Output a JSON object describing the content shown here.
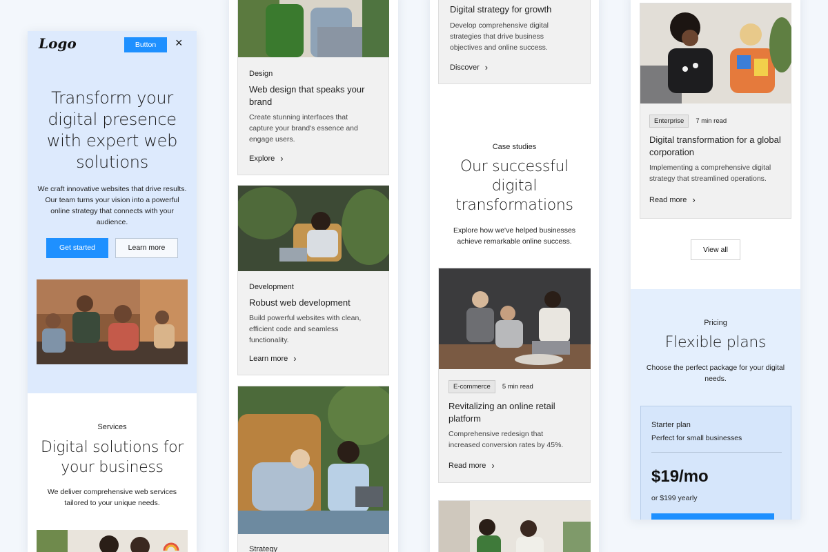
{
  "screen1": {
    "logo": "Logo",
    "header_button": "Button",
    "close_glyph": "×",
    "hero_title": "Transform your digital presence with expert web solutions",
    "hero_desc": "We craft innovative websites that drive results. Our team turns your vision into a powerful online strategy that connects with your audience.",
    "primary_cta": "Get started",
    "secondary_cta": "Learn more",
    "services_eyebrow": "Services",
    "services_title": "Digital solutions for your business",
    "services_desc": "We deliver comprehensive web services tailored to your unique needs."
  },
  "screen2": {
    "cards": [
      {
        "eyebrow": "Design",
        "title": "Web design that speaks your brand",
        "desc": "Create stunning interfaces that capture your brand's essence and engage users.",
        "link": "Explore"
      },
      {
        "eyebrow": "Development",
        "title": "Robust web development",
        "desc": "Build powerful websites with clean, efficient code and seamless functionality.",
        "link": "Learn more"
      }
    ],
    "bottom_eyebrow": "Strategy"
  },
  "screen3": {
    "top_card": {
      "title": "Digital strategy for growth",
      "desc": "Develop comprehensive digital strategies that drive business objectives and online success.",
      "link": "Discover"
    },
    "eyebrow": "Case studies",
    "title": "Our successful digital transformations",
    "desc": "Explore how we've helped businesses achieve remarkable online success.",
    "case_card": {
      "tag": "E-commerce",
      "read_time": "5 min read",
      "title": "Revitalizing an online retail platform",
      "desc": "Comprehensive redesign that increased conversion rates by 45%.",
      "link": "Read more"
    }
  },
  "screen4": {
    "case_card": {
      "tag": "Enterprise",
      "read_time": "7 min read",
      "title": "Digital transformation for a global corporation",
      "desc": "Implementing a comprehensive digital strategy that streamlined operations.",
      "link": "Read more"
    },
    "view_all": "View all",
    "pricing_eyebrow": "Pricing",
    "pricing_title": "Flexible plans",
    "pricing_desc": "Choose the perfect package for your digital needs.",
    "plan": {
      "name": "Starter plan",
      "subtitle": "Perfect for small businesses",
      "price": "$19/mo",
      "yearly": "or $199 yearly"
    }
  },
  "icons": {
    "chevron": "›",
    "close": "×"
  },
  "colors": {
    "accent": "#1e90ff",
    "hero_bg": "#ddeafd",
    "pricing_bg": "#e4effd",
    "plan_bg": "#d6e6fb",
    "card_bg": "#f1f1f1",
    "page_bg": "#f3f7fc"
  }
}
